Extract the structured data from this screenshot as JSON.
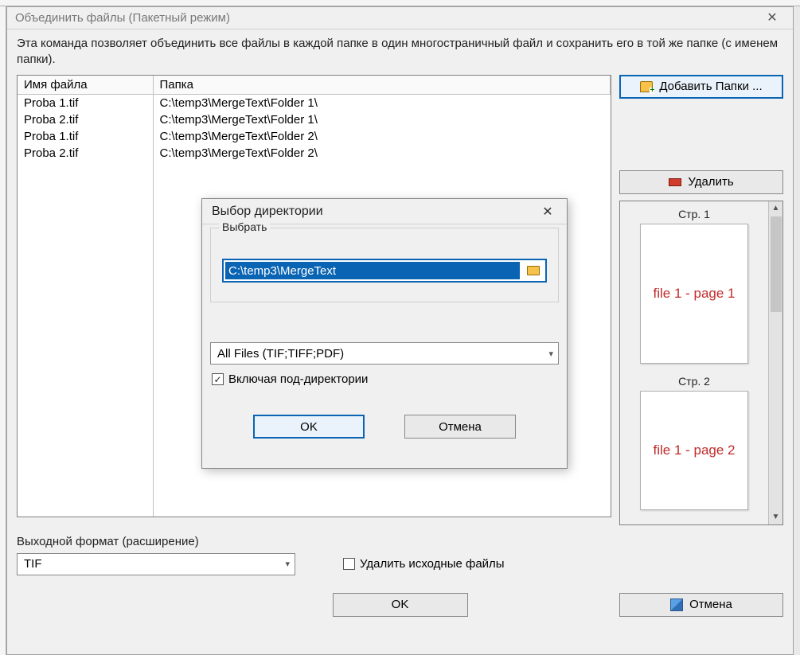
{
  "window": {
    "title": "Объединить файлы (Пакетный режим)",
    "description": "Эта команда позволяет объединить все файлы в каждой папке в один многостраничный файл и сохранить его в той же папке (с именем папки)."
  },
  "table": {
    "headers": {
      "file": "Имя файла",
      "folder": "Папка"
    },
    "rows": [
      {
        "file": "Proba 1.tif",
        "folder": "C:\\temp3\\MergeText\\Folder 1\\"
      },
      {
        "file": "Proba 2.tif",
        "folder": "C:\\temp3\\MergeText\\Folder 1\\"
      },
      {
        "file": "Proba 1.tif",
        "folder": "C:\\temp3\\MergeText\\Folder 2\\"
      },
      {
        "file": "Proba 2.tif",
        "folder": "C:\\temp3\\MergeText\\Folder 2\\"
      }
    ]
  },
  "buttons": {
    "add_folders": "Добавить Папки ...",
    "delete": "Удалить",
    "ok": "OK",
    "cancel": "Отмена"
  },
  "preview": {
    "pages": [
      {
        "label": "Стр. 1",
        "text": "file 1 - page 1"
      },
      {
        "label": "Стр. 2",
        "text": "file 1 - page 2"
      }
    ]
  },
  "output": {
    "label": "Выходной формат (расширение)",
    "value": "TIF",
    "delete_sources_label": "Удалить исходные файлы",
    "delete_sources_checked": false
  },
  "dialog": {
    "title": "Выбор директории",
    "group_label": "Выбрать",
    "path_value": "C:\\temp3\\MergeText",
    "filter_value": "All Files (TIF;TIFF;PDF)",
    "include_sub_label": "Включая под-директории",
    "include_sub_checked": true,
    "ok": "OK",
    "cancel": "Отмена"
  }
}
